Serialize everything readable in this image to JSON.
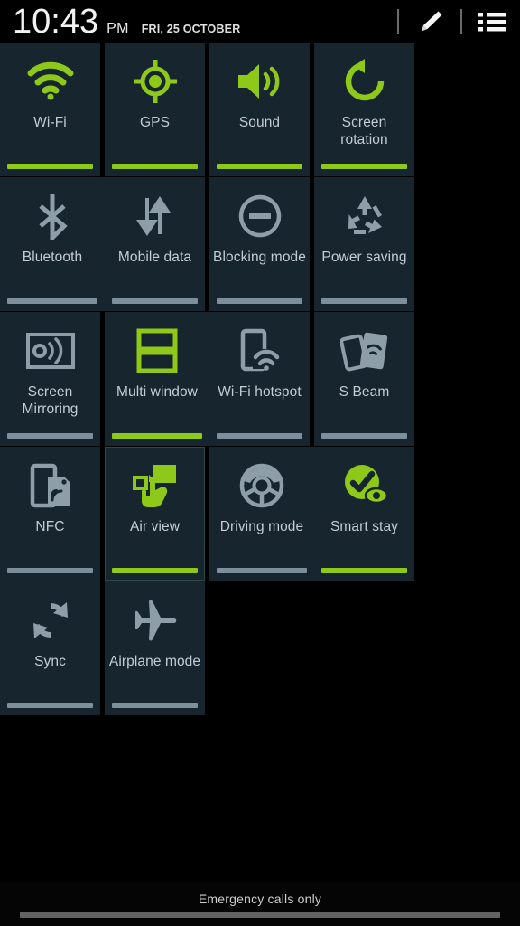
{
  "statusbar": {
    "time": "10:43",
    "ampm": "PM",
    "date": "FRI, 25 OCTOBER",
    "edit_icon": "pencil-icon",
    "list_icon": "list-icon"
  },
  "colors": {
    "accent_on": "#8ec919",
    "inactive": "#8d9ea9",
    "tile_bg": "#17252f",
    "label": "#c3ccd2",
    "bar_off": "#7d8f9b"
  },
  "toggles": [
    {
      "id": "wifi",
      "label": "Wi-Fi",
      "icon": "wifi-icon",
      "state": "on",
      "highlighted": false
    },
    {
      "id": "gps",
      "label": "GPS",
      "icon": "gps-icon",
      "state": "on",
      "highlighted": false
    },
    {
      "id": "sound",
      "label": "Sound",
      "icon": "sound-icon",
      "state": "on",
      "highlighted": false
    },
    {
      "id": "screen-rotation",
      "label": "Screen rotation",
      "icon": "screen-rotation-icon",
      "state": "on",
      "highlighted": false
    },
    {
      "id": "bluetooth",
      "label": "Bluetooth",
      "icon": "bluetooth-icon",
      "state": "off",
      "highlighted": false
    },
    {
      "id": "mobile-data",
      "label": "Mobile data",
      "icon": "mobile-data-icon",
      "state": "off",
      "highlighted": false
    },
    {
      "id": "blocking-mode",
      "label": "Blocking mode",
      "icon": "blocking-mode-icon",
      "state": "off",
      "highlighted": false
    },
    {
      "id": "power-saving",
      "label": "Power saving",
      "icon": "recycle-icon",
      "state": "off",
      "highlighted": false
    },
    {
      "id": "screen-mirroring",
      "label": "Screen Mirroring",
      "icon": "screen-mirroring-icon",
      "state": "off",
      "highlighted": false
    },
    {
      "id": "multi-window",
      "label": "Multi window",
      "icon": "multi-window-icon",
      "state": "on",
      "highlighted": false
    },
    {
      "id": "wifi-hotspot",
      "label": "Wi-Fi hotspot",
      "icon": "wifi-hotspot-icon",
      "state": "off",
      "highlighted": false
    },
    {
      "id": "s-beam",
      "label": "S Beam",
      "icon": "s-beam-icon",
      "state": "off",
      "highlighted": false
    },
    {
      "id": "nfc",
      "label": "NFC",
      "icon": "nfc-icon",
      "state": "off",
      "highlighted": false
    },
    {
      "id": "air-view",
      "label": "Air view",
      "icon": "air-view-icon",
      "state": "on",
      "highlighted": true
    },
    {
      "id": "driving-mode",
      "label": "Driving mode",
      "icon": "driving-mode-icon",
      "state": "off",
      "highlighted": false
    },
    {
      "id": "smart-stay",
      "label": "Smart stay",
      "icon": "smart-stay-icon",
      "state": "on",
      "highlighted": false
    },
    {
      "id": "sync",
      "label": "Sync",
      "icon": "sync-icon",
      "state": "off",
      "highlighted": false
    },
    {
      "id": "airplane-mode",
      "label": "Airplane mode",
      "icon": "airplane-icon",
      "state": "off",
      "highlighted": false
    }
  ],
  "bottombar": {
    "carrier_status": "Emergency calls only"
  }
}
